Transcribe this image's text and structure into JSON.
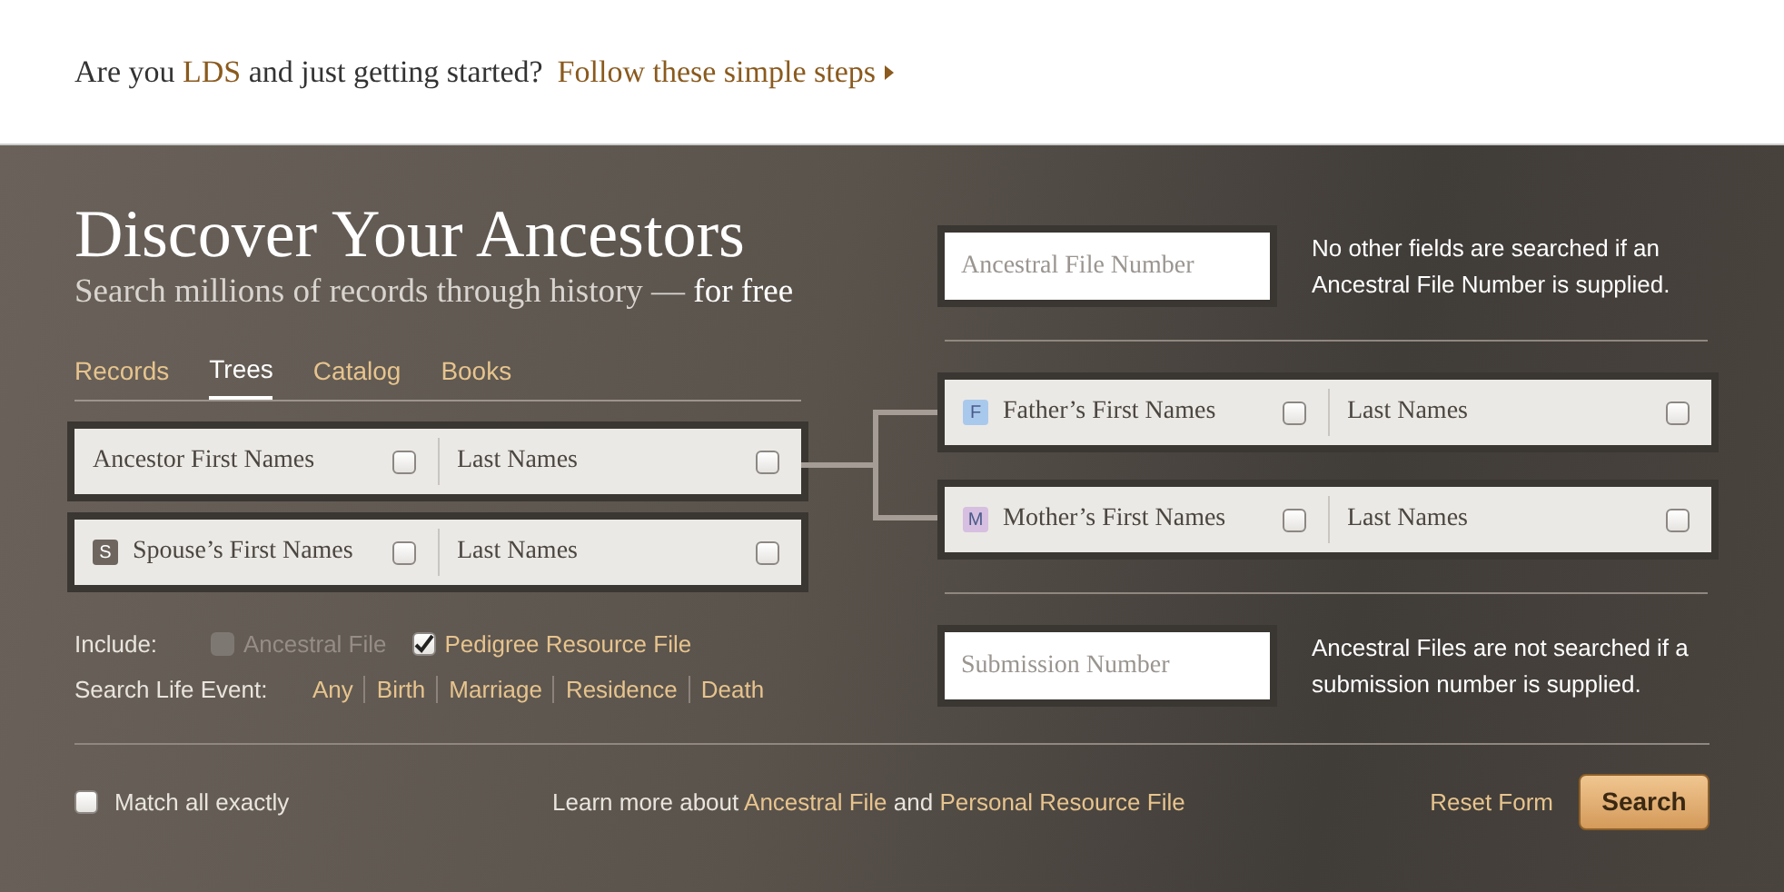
{
  "banner": {
    "intro": "Are you",
    "highlight": "LDS",
    "outro": "and just getting started?",
    "link": "Follow these simple steps"
  },
  "title": "Discover Your Ancestors",
  "subtitle": {
    "text": "Search millions of records through history —",
    "emphasis": "for free"
  },
  "tabs": [
    {
      "label": "Records",
      "selected": false
    },
    {
      "label": "Trees",
      "selected": true
    },
    {
      "label": "Catalog",
      "selected": false
    },
    {
      "label": "Books",
      "selected": false
    }
  ],
  "person_rows": [
    {
      "badge": null,
      "first": {
        "placeholder": "Ancestor First Names",
        "checked": false
      },
      "last": {
        "placeholder": "Last Names",
        "checked": false
      }
    },
    {
      "badge": {
        "letter": "S",
        "color": "#6d655e"
      },
      "first": {
        "placeholder": "Spouse’s First Names",
        "checked": false
      },
      "last": {
        "placeholder": "Last Names",
        "checked": false
      }
    }
  ],
  "include": {
    "label": "Include:",
    "options": [
      {
        "label": "Ancestral File",
        "checked": false,
        "disabled": true
      },
      {
        "label": "Pedigree Resource File",
        "checked": true,
        "disabled": false
      }
    ]
  },
  "life_event": {
    "label": "Search Life Event:",
    "options": [
      "Any",
      "Birth",
      "Marriage",
      "Residence",
      "Death"
    ]
  },
  "ancestral_file": {
    "placeholder": "Ancestral File Number",
    "note": "No other fields are searched if an Ancestral File Number is supplied."
  },
  "parent_rows": [
    {
      "badge": {
        "letter": "F",
        "color": "#a9c9ec"
      },
      "first": {
        "placeholder": "Father’s First Names",
        "checked": false
      },
      "last": {
        "placeholder": "Last Names",
        "checked": false
      }
    },
    {
      "badge": {
        "letter": "M",
        "color": "#d6bfe0"
      },
      "first": {
        "placeholder": "Mother’s First Names",
        "checked": false
      },
      "last": {
        "placeholder": "Last Names",
        "checked": false
      }
    }
  ],
  "submission": {
    "placeholder": "Submission Number",
    "note": "Ancestral Files are not searched if a submission number is supplied."
  },
  "footer": {
    "match_exact": {
      "label": "Match all exactly",
      "checked": false
    },
    "learn": {
      "intro": "Learn more about",
      "link1": "Ancestral File",
      "joiner": "and",
      "link2": "Personal Resource File"
    },
    "reset": "Reset Form",
    "search": "Search"
  }
}
